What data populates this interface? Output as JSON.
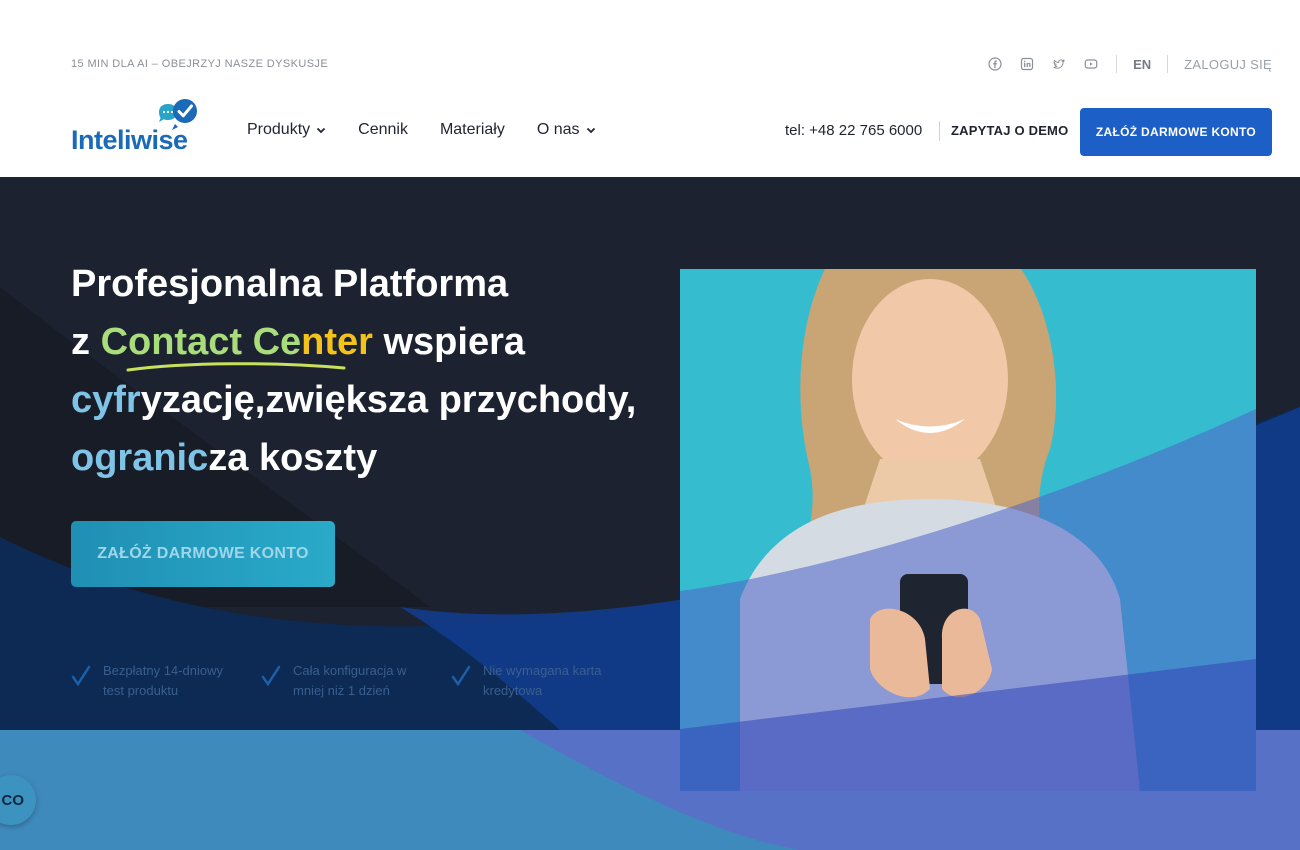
{
  "topbar": {
    "promo": "15 MIN DLA AI – OBEJRZYJ NASZE DYSKUSJE",
    "social_icons": [
      "facebook-icon",
      "linkedin-icon",
      "twitter-icon",
      "youtube-icon"
    ],
    "lang": "EN",
    "login": "ZALOGUJ SIĘ"
  },
  "header": {
    "logo_text": "Inteliwise",
    "nav": [
      {
        "label": "Produkty",
        "dropdown": true
      },
      {
        "label": "Cennik",
        "dropdown": false
      },
      {
        "label": "Materiały",
        "dropdown": false
      },
      {
        "label": "O nas",
        "dropdown": true
      }
    ],
    "phone": "tel: +48 22 765 6000",
    "demo": "ZAPYTAJ O DEMO",
    "cta": "ZAŁÓŻ DARMOWE KONTO"
  },
  "hero": {
    "line1": "Profesjonalna Platforma",
    "line2_pre": "z ",
    "line2_green": "Contact Ce",
    "line2_yellow": "nter",
    "line2_post": " wspiera",
    "line3_blue": "cyfr",
    "line3_rest": "yzację,zwiększa przychody,",
    "line4_blue": "ogranic",
    "line4_rest": "za koszty",
    "cta": "ZAŁÓŻ DARMOWE KONTO",
    "features": [
      {
        "text": "Bezpłatny 14-dniowy test produktu"
      },
      {
        "text": "Cała konfiguracja w mniej niż 1 dzień"
      },
      {
        "text": "Nie wymagana karta kredytowa"
      }
    ]
  },
  "chat_widget": {
    "label": "CO"
  },
  "colors": {
    "brand_blue": "#1c5fc6",
    "hero_bg": "#1d2230",
    "photo_bg": "#35bccf",
    "accent_green": "#a9dc7a",
    "accent_yellow": "#f3c31c"
  }
}
